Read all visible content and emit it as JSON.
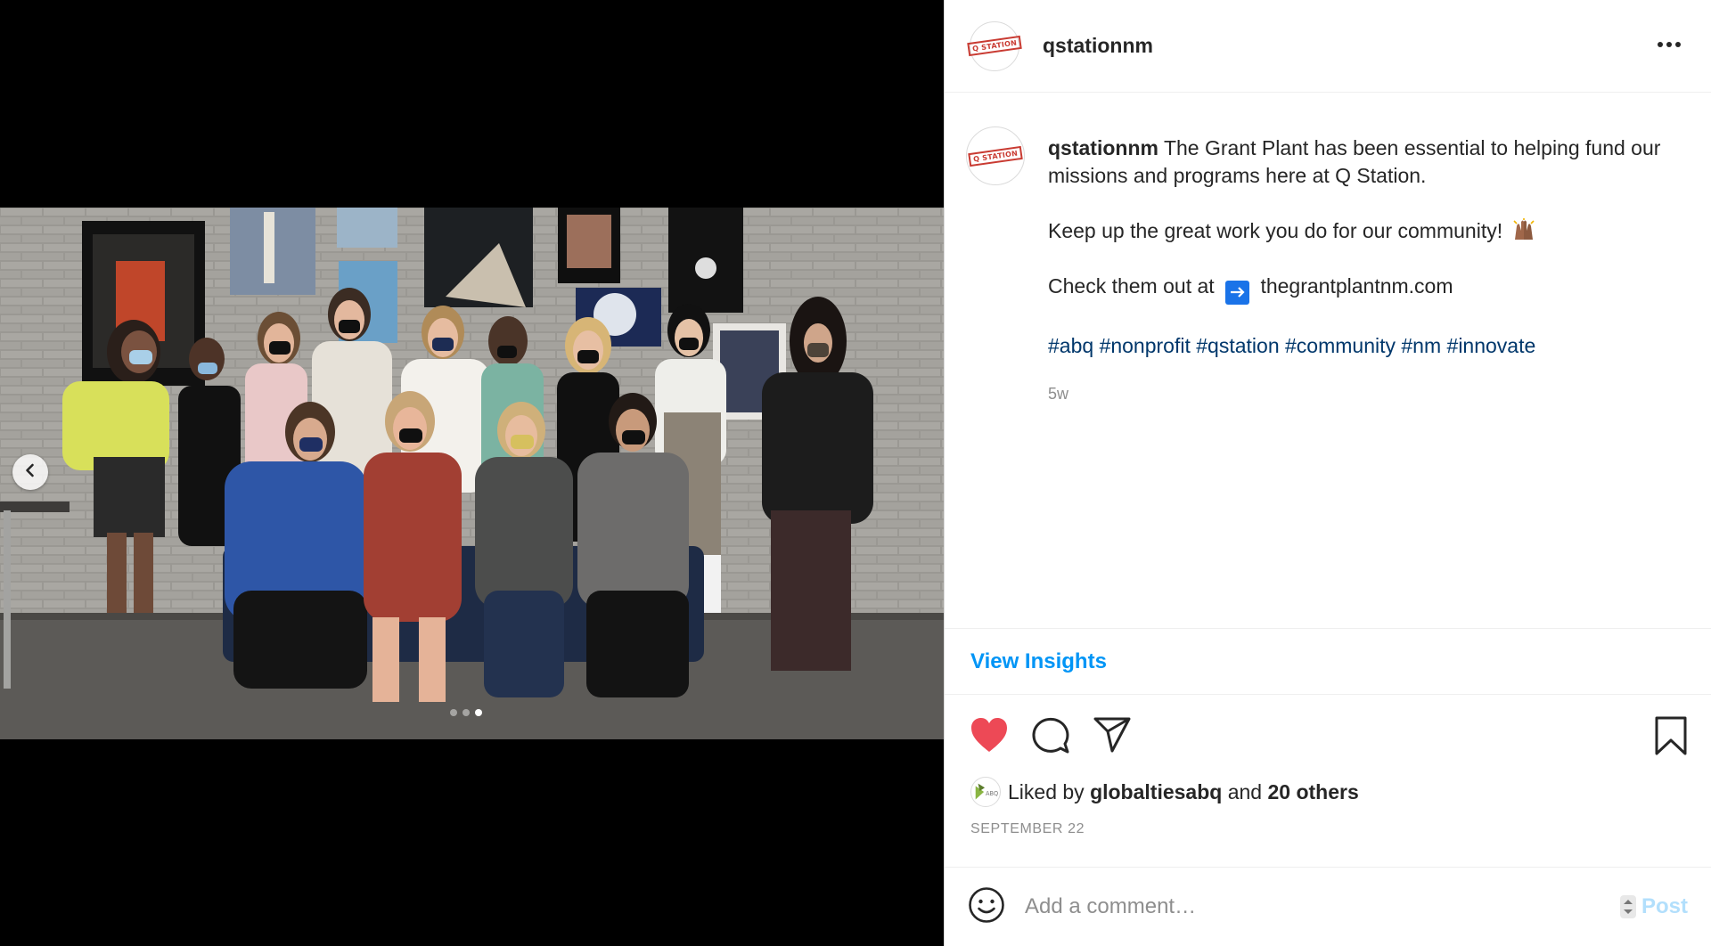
{
  "post": {
    "username": "qstationnm",
    "logo_text": "Q STATION",
    "caption": {
      "username": "qstationnm",
      "line1": "The Grant Plant has been essential to helping fund our missions and programs here at Q Station.",
      "line2": "Keep up the great work you do for our community!",
      "line3_prefix": "Check them out at",
      "line3_link": "thegrantplantnm.com",
      "hashtags": [
        "#abq",
        "#nonprofit",
        "#qstation",
        "#community",
        "#nm",
        "#innovate"
      ]
    },
    "time_ago": "5w",
    "view_insights": "View Insights",
    "likes": {
      "prefix": "Liked by",
      "first_liker": "globaltiesabq",
      "conjunction": "and",
      "others": "20 others",
      "liker_avatar_text": "ABQ"
    },
    "date": "SEPTEMBER 22",
    "comment_placeholder": "Add a comment…",
    "post_label": "Post"
  },
  "carousel": {
    "count": 3,
    "active_index": 3
  },
  "colors": {
    "like_red": "#ed4956",
    "link_blue": "#0095f6",
    "hashtag_blue": "#00376b",
    "brand_red": "#c93b32"
  },
  "icons": [
    "chevron-left-icon",
    "more-horizontal-icon",
    "heart-filled-icon",
    "comment-icon",
    "share-icon",
    "bookmark-icon",
    "smiley-icon",
    "arrow-right-icon",
    "raised-hands-icon"
  ]
}
